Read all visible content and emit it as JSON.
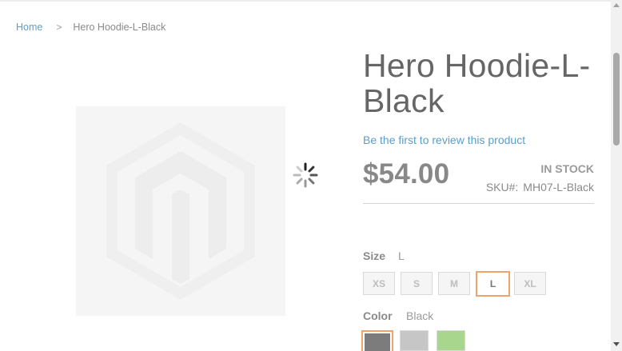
{
  "breadcrumb": {
    "home": "Home",
    "separator": ">",
    "current": "Hero Hoodie-L-Black"
  },
  "gallery": {
    "placeholder_icon": "magento-logo-icon",
    "loading_icon": "loading-spinner-icon"
  },
  "product": {
    "title": "Hero Hoodie-L-Black",
    "review_link": "Be the first to review this product",
    "price": "$54.00",
    "stock": "IN STOCK",
    "sku_label": "SKU#:",
    "sku_value": "MH07-L-Black"
  },
  "size": {
    "label": "Size",
    "selected": "L",
    "options": [
      "XS",
      "S",
      "M",
      "L",
      "XL"
    ]
  },
  "color": {
    "label": "Color",
    "selected": "Black",
    "swatches": [
      {
        "color": "#7c7c7c",
        "selected": true
      },
      {
        "color": "#c6c6c6",
        "selected": false
      },
      {
        "color": "#a8d68c",
        "selected": false
      }
    ]
  },
  "colors": {
    "link": "#5a9ec9",
    "selected_border": "#f0a36a",
    "placeholder_bg": "#f5f5f5"
  }
}
